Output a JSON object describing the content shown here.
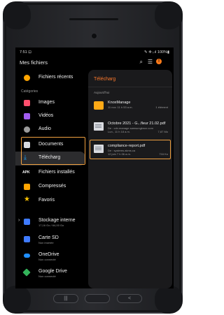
{
  "status": {
    "time": "7:51 ⊡",
    "indicators": "✎ ✲ ᵢ.ıl 100%▮"
  },
  "app": {
    "title": "Mes fichiers"
  },
  "drawer": {
    "recent": "Fichiers récents",
    "categories_label": "Catégories",
    "categories": [
      {
        "label": "Images",
        "color": "#ff4f6d"
      },
      {
        "label": "Vidéos",
        "color": "#a15cf0"
      },
      {
        "label": "Audio",
        "color": "#9b9b9b"
      },
      {
        "label": "Documents",
        "color": "#d9dbe0"
      },
      {
        "label": "Télécharg",
        "color": "#1ea5ff"
      },
      {
        "label": "Fichiers installés",
        "color": "#ffffff"
      },
      {
        "label": "Compressés",
        "color": "#ffa500"
      },
      {
        "label": "Favoris",
        "color": "#ffc500"
      }
    ],
    "apk_badge": "APK",
    "storage": [
      {
        "label": "Stockage interne",
        "sub": "17,16 Go / 64,00 Go",
        "color": "#3f7bff"
      },
      {
        "label": "Carte SD",
        "sub": "Non insérée",
        "color": "#3f7bff"
      },
      {
        "label": "OneDrive",
        "sub": "Non connecté",
        "color": "#1f8fff"
      },
      {
        "label": "Google Drive",
        "sub": "Non connecté",
        "color": "#33b35a"
      }
    ]
  },
  "panel": {
    "title": "Télécharg",
    "group": "Aujourd'hui",
    "files": [
      {
        "name": "KnoxManage",
        "source": "11 nov. 11 h 53 a.m.",
        "date": "",
        "meta": "1 élément",
        "type": "folder"
      },
      {
        "name": "Octobre 2021 - G...fleur 21.02.pdf",
        "source": "De : cdn.manage.samsungknox.com",
        "date": "Lun., 11 h 18 a.m.",
        "meta": "7,87 Mo",
        "type": "doc"
      },
      {
        "name": "compliance-report.pdf",
        "source": "De : systems.akms.ca",
        "date": "12 juin 7 h 06 a.m.",
        "meta": "716 Ko",
        "type": "doc"
      }
    ]
  },
  "hw_buttons": {
    "recent": "|||",
    "home": "",
    "back": "<"
  }
}
